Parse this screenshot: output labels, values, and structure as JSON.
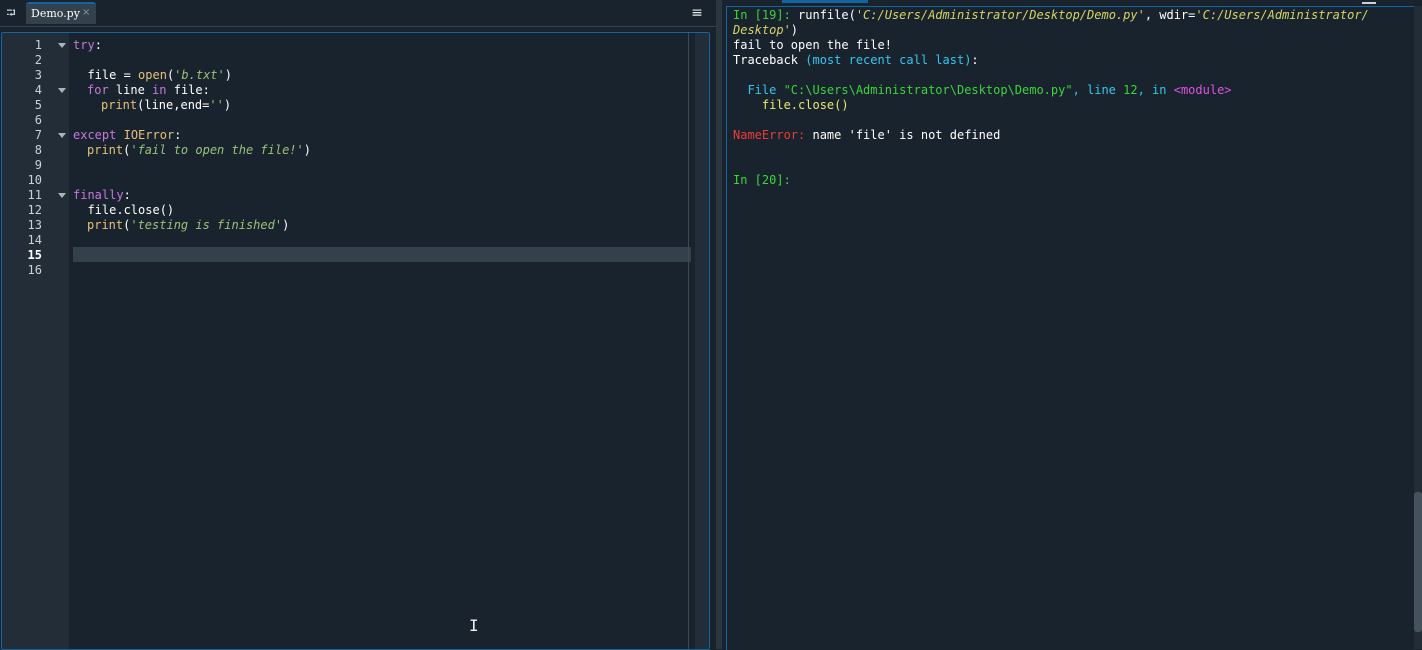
{
  "editor": {
    "tab_label": "Demo.py",
    "tab_close": "×",
    "browse_tabs_icon": "⮒",
    "options_icon": "≡",
    "current_line": "15",
    "line_numbers": [
      "1",
      "2",
      "3",
      "4",
      "5",
      "6",
      "7",
      "8",
      "9",
      "10",
      "11",
      "12",
      "13",
      "14",
      "15",
      "16"
    ],
    "code": {
      "l1_kw": "try",
      "l1_rest": ":",
      "l3_a": "  file = ",
      "l3_fn": "open",
      "l3_b": "(",
      "l3_str": "'b.txt'",
      "l3_c": ")",
      "l4_kw1": "for",
      "l4_a": " line ",
      "l4_kw2": "in",
      "l4_b": " file:",
      "l5_fn": "print",
      "l5_a": "(line,end=",
      "l5_str": "''",
      "l5_b": ")",
      "l7_kw": "except",
      "l7_a": " ",
      "l7_cls": "IOError",
      "l7_b": ":",
      "l8_fn": "print",
      "l8_a": "(",
      "l8_str": "'fail to open the file!'",
      "l8_b": ")",
      "l11_kw": "finally",
      "l11_a": ":",
      "l12": "  file.close()",
      "l13_fn": "print",
      "l13_a": "(",
      "l13_str": "'testing is finished'",
      "l13_b": ")"
    }
  },
  "console": {
    "run_prompt": "In [19]:",
    "run_cmd_a": " runfile(",
    "run_path": "'C:/Users/Administrator/Desktop/Demo.py'",
    "run_cmd_b": ", wdir=",
    "run_wdir_a": "'C:/Users/Administrator/",
    "run_wdir_b": "Desktop'",
    "run_cmd_c": ")",
    "output_line": "fail to open the file!",
    "traceback_a": "Traceback ",
    "traceback_b": "(most recent call last)",
    "traceback_c": ":",
    "file_a": "  File ",
    "file_path": "\"C:\\Users\\Administrator\\Desktop\\Demo.py\"",
    "file_b": ", line ",
    "file_line": "12",
    "file_c": ", in ",
    "file_module": "<module>",
    "code_line": "    file.close()",
    "error_name": "NameError:",
    "error_msg": " name 'file' is not defined",
    "next_prompt": "In [20]:"
  },
  "colors": {
    "background": "#19232d",
    "accent": "#1464a0",
    "keyword": "#c678dd",
    "builtin": "#e5c07b",
    "string": "#98c379",
    "prompt": "#3bd43b",
    "traceback": "#36c5f0",
    "error": "#ef3a3a"
  }
}
